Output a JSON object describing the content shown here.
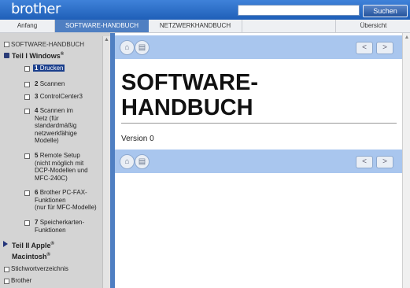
{
  "header": {
    "logo": "brother",
    "search_value": "",
    "search_button": "Suchen"
  },
  "tabs": {
    "anfang": "Anfang",
    "software": "SOFTWARE-HANDBUCH",
    "netzwerk": "NETZWERKHANDBUCH",
    "uebersicht": "Übersicht"
  },
  "sidebar": {
    "root": "SOFTWARE-HANDBUCH",
    "teil1": "Teil I Windows",
    "teil1_sup": "®",
    "items": [
      {
        "num": "1",
        "label": "Drucken"
      },
      {
        "num": "2",
        "label": "Scannen"
      },
      {
        "num": "3",
        "label": "ControlCenter3"
      },
      {
        "num": "4",
        "label": "Scannen im",
        "lines": [
          "Netz (für",
          "standardmäßig",
          "netzwerkfähige",
          "Modelle)"
        ]
      },
      {
        "num": "5",
        "label": "Remote Setup",
        "lines": [
          "(nicht möglich mit",
          "DCP-Modellen und",
          "MFC-240C)"
        ]
      },
      {
        "num": "6",
        "label": "Brother PC-FAX-",
        "lines": [
          "Funktionen",
          "(nur für MFC-Modelle)"
        ]
      },
      {
        "num": "7",
        "label": "Speicherkarten-",
        "lines": [
          "Funktionen"
        ]
      }
    ],
    "teil2_a": "Teil II Apple",
    "teil2_b": "Macintosh",
    "sup_reg": "®",
    "index": "Stichwortverzeichnis",
    "brother": "Brother"
  },
  "document": {
    "title_line1": "SOFTWARE-",
    "title_line2": "HANDBUCH",
    "version": "Version 0"
  },
  "icons": {
    "home": "home-icon",
    "print": "print-icon",
    "prev": "arrow-left-icon",
    "next": "arrow-right-icon"
  },
  "colors": {
    "accent": "#4f7fc2",
    "topbar": "#1f5fb8",
    "navbar": "#a9c6ee",
    "sidebar": "#d4d4d4"
  }
}
